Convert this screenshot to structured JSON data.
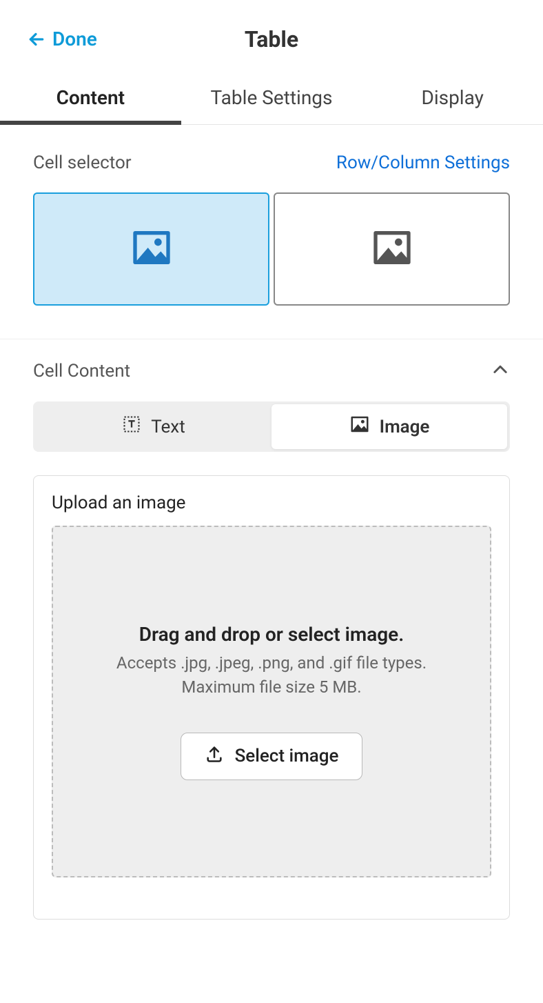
{
  "header": {
    "back_label": "Done",
    "title": "Table"
  },
  "tabs": {
    "content": "Content",
    "settings": "Table Settings",
    "display": "Display"
  },
  "cell_selector": {
    "label": "Cell selector",
    "settings_link": "Row/Column Settings"
  },
  "cell_content": {
    "label": "Cell Content",
    "segmented": {
      "text": "Text",
      "image": "Image"
    },
    "upload": {
      "title": "Upload an image",
      "drop_main": "Drag and drop or select image.",
      "drop_sub_line1": "Accepts .jpg, .jpeg, .png, and .gif file types.",
      "drop_sub_line2": "Maximum file size 5 MB.",
      "button": "Select image"
    }
  }
}
